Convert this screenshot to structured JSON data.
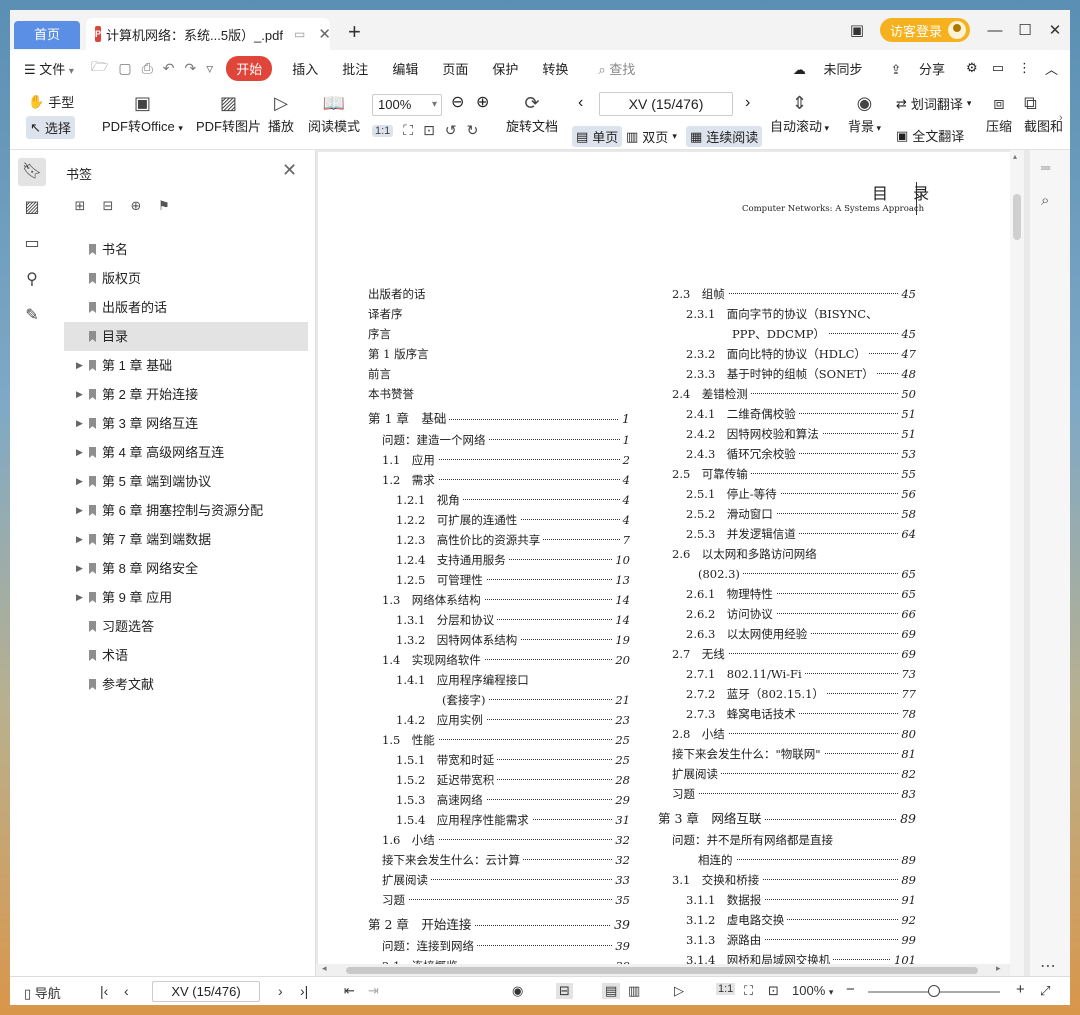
{
  "tabs": {
    "home": "首页",
    "doc_title": "计算机网络：系统...5版）_.pdf"
  },
  "window": {
    "login": "访客登录"
  },
  "menu": {
    "file": "文件",
    "start": "开始",
    "items": [
      "插入",
      "批注",
      "编辑",
      "页面",
      "保护",
      "转换"
    ],
    "search": "查找",
    "unsync": "未同步",
    "share": "分享"
  },
  "toolbar": {
    "hand": "手型",
    "select": "选择",
    "pdf_to_office": "PDF转Office",
    "pdf_to_image": "PDF转图片",
    "play": "播放",
    "read_mode": "阅读模式",
    "zoom": "100%",
    "page_indicator": "XV (15/476)",
    "rotate": "旋转文档",
    "single_page": "单页",
    "double_page": "双页",
    "continuous": "连续阅读",
    "auto_scroll": "自动滚动",
    "background": "背景",
    "word_translate": "划词翻译",
    "full_translate": "全文翻译",
    "compress": "压缩",
    "screenshot": "截图和"
  },
  "sidebar": {
    "title": "书签",
    "bookmarks": [
      {
        "label": "书名",
        "expandable": false,
        "active": false
      },
      {
        "label": "版权页",
        "expandable": false,
        "active": false
      },
      {
        "label": "出版者的话",
        "expandable": false,
        "active": false
      },
      {
        "label": "目录",
        "expandable": false,
        "active": true
      },
      {
        "label": "第 1 章 基础",
        "expandable": true,
        "active": false
      },
      {
        "label": "第 2 章 开始连接",
        "expandable": true,
        "active": false
      },
      {
        "label": "第 3 章 网络互连",
        "expandable": true,
        "active": false
      },
      {
        "label": "第 4 章 高级网络互连",
        "expandable": true,
        "active": false
      },
      {
        "label": "第 5 章 端到端协议",
        "expandable": true,
        "active": false
      },
      {
        "label": "第 6 章 拥塞控制与资源分配",
        "expandable": true,
        "active": false
      },
      {
        "label": "第 7 章 端到端数据",
        "expandable": true,
        "active": false
      },
      {
        "label": "第 8 章 网络安全",
        "expandable": true,
        "active": false
      },
      {
        "label": "第 9 章 应用",
        "expandable": true,
        "active": false
      },
      {
        "label": "习题选答",
        "expandable": false,
        "active": false
      },
      {
        "label": "术语",
        "expandable": false,
        "active": false
      },
      {
        "label": "参考文献",
        "expandable": false,
        "active": false
      }
    ]
  },
  "page": {
    "heading": "目 录",
    "subheading": "Computer Networks: A Systems Approach",
    "toc_left": [
      {
        "t": "出版者的话",
        "p": "",
        "lv": 0
      },
      {
        "t": "译者序",
        "p": "",
        "lv": 0
      },
      {
        "t": "序言",
        "p": "",
        "lv": 0
      },
      {
        "t": "第 1 版序言",
        "p": "",
        "lv": 0
      },
      {
        "t": "前言",
        "p": "",
        "lv": 0
      },
      {
        "t": "本书赞誉",
        "p": "",
        "lv": 0
      },
      {
        "t": "第 1 章　基础",
        "p": "1",
        "lv": 9
      },
      {
        "t": "问题：建造一个网络",
        "p": "1",
        "lv": 1
      },
      {
        "t": "1.1　应用",
        "p": "2",
        "lv": 1
      },
      {
        "t": "1.2　需求",
        "p": "4",
        "lv": 1
      },
      {
        "t": "1.2.1　视角",
        "p": "4",
        "lv": 2
      },
      {
        "t": "1.2.2　可扩展的连通性",
        "p": "4",
        "lv": 2
      },
      {
        "t": "1.2.3　高性价比的资源共享",
        "p": "7",
        "lv": 2
      },
      {
        "t": "1.2.4　支持通用服务",
        "p": "10",
        "lv": 2
      },
      {
        "t": "1.2.5　可管理性",
        "p": "13",
        "lv": 2
      },
      {
        "t": "1.3　网络体系结构",
        "p": "14",
        "lv": 1
      },
      {
        "t": "1.3.1　分层和协议",
        "p": "14",
        "lv": 2
      },
      {
        "t": "1.3.2　因特网体系结构",
        "p": "19",
        "lv": 2
      },
      {
        "t": "1.4　实现网络软件",
        "p": "20",
        "lv": 1
      },
      {
        "t": "1.4.1　应用程序编程接口",
        "p": "",
        "lv": 2
      },
      {
        "t": "(套接字)",
        "p": "21",
        "lv": 3
      },
      {
        "t": "1.4.2　应用实例",
        "p": "23",
        "lv": 2
      },
      {
        "t": "1.5　性能",
        "p": "25",
        "lv": 1
      },
      {
        "t": "1.5.1　带宽和时延",
        "p": "25",
        "lv": 2
      },
      {
        "t": "1.5.2　延迟带宽积",
        "p": "28",
        "lv": 2
      },
      {
        "t": "1.5.3　高速网络",
        "p": "29",
        "lv": 2
      },
      {
        "t": "1.5.4　应用程序性能需求",
        "p": "31",
        "lv": 2
      },
      {
        "t": "1.6　小结",
        "p": "32",
        "lv": 1
      },
      {
        "t": "接下来会发生什么：云计算",
        "p": "32",
        "lv": 1
      },
      {
        "t": "扩展阅读",
        "p": "33",
        "lv": 1
      },
      {
        "t": "习题",
        "p": "35",
        "lv": 1
      },
      {
        "t": "第 2 章　开始连接",
        "p": "39",
        "lv": 9
      },
      {
        "t": "问题：连接到网络",
        "p": "39",
        "lv": 1
      },
      {
        "t": "2.1　连接概览",
        "p": "39",
        "lv": 1
      }
    ],
    "toc_right": [
      {
        "t": "2.3　组帧",
        "p": "45",
        "lv": 1
      },
      {
        "t": "2.3.1　面向字节的协议（BISYNC、",
        "p": "",
        "lv": 2
      },
      {
        "t": "PPP、DDCMP）",
        "p": "45",
        "lv": 3
      },
      {
        "t": "2.3.2　面向比特的协议（HDLC）",
        "p": "47",
        "lv": 2
      },
      {
        "t": "2.3.3　基于时钟的组帧（SONET）",
        "p": "48",
        "lv": 2
      },
      {
        "t": "2.4　差错检测",
        "p": "50",
        "lv": 1
      },
      {
        "t": "2.4.1　二维奇偶校验",
        "p": "51",
        "lv": 2
      },
      {
        "t": "2.4.2　因特网校验和算法",
        "p": "51",
        "lv": 2
      },
      {
        "t": "2.4.3　循环冗余校验",
        "p": "53",
        "lv": 2
      },
      {
        "t": "2.5　可靠传输",
        "p": "55",
        "lv": 1
      },
      {
        "t": "2.5.1　停止-等待",
        "p": "56",
        "lv": 2
      },
      {
        "t": "2.5.2　滑动窗口",
        "p": "58",
        "lv": 2
      },
      {
        "t": "2.5.3　并发逻辑信道",
        "p": "64",
        "lv": 2
      },
      {
        "t": "2.6　以太网和多路访问网络",
        "p": "",
        "lv": 1
      },
      {
        "t": "(802.3)",
        "p": "65",
        "lv": 4
      },
      {
        "t": "2.6.1　物理特性",
        "p": "65",
        "lv": 2
      },
      {
        "t": "2.6.2　访问协议",
        "p": "66",
        "lv": 2
      },
      {
        "t": "2.6.3　以太网使用经验",
        "p": "69",
        "lv": 2
      },
      {
        "t": "2.7　无线",
        "p": "69",
        "lv": 1
      },
      {
        "t": "2.7.1　802.11/Wi-Fi",
        "p": "73",
        "lv": 2
      },
      {
        "t": "2.7.2　蓝牙（802.15.1）",
        "p": "77",
        "lv": 2
      },
      {
        "t": "2.7.3　蜂窝电话技术",
        "p": "78",
        "lv": 2
      },
      {
        "t": "2.8　小结",
        "p": "80",
        "lv": 1
      },
      {
        "t": "接下来会发生什么：\"物联网\"",
        "p": "81",
        "lv": 1
      },
      {
        "t": "扩展阅读",
        "p": "82",
        "lv": 1
      },
      {
        "t": "习题",
        "p": "83",
        "lv": 1
      },
      {
        "t": "第 3 章　网络互联",
        "p": "89",
        "lv": 9
      },
      {
        "t": "问题：并不是所有网络都是直接",
        "p": "",
        "lv": 1
      },
      {
        "t": "相连的",
        "p": "89",
        "lv": 4
      },
      {
        "t": "3.1　交换和桥接",
        "p": "89",
        "lv": 1
      },
      {
        "t": "3.1.1　数据报",
        "p": "91",
        "lv": 2
      },
      {
        "t": "3.1.2　虚电路交换",
        "p": "92",
        "lv": 2
      },
      {
        "t": "3.1.3　源路由",
        "p": "99",
        "lv": 2
      },
      {
        "t": "3.1.4　网桥和局域网交换机",
        "p": "101",
        "lv": 2
      }
    ]
  },
  "statusbar": {
    "nav": "导航",
    "page_indicator": "XV (15/476)",
    "zoom": "100%",
    "zoom_level_fraction": 0.5
  }
}
